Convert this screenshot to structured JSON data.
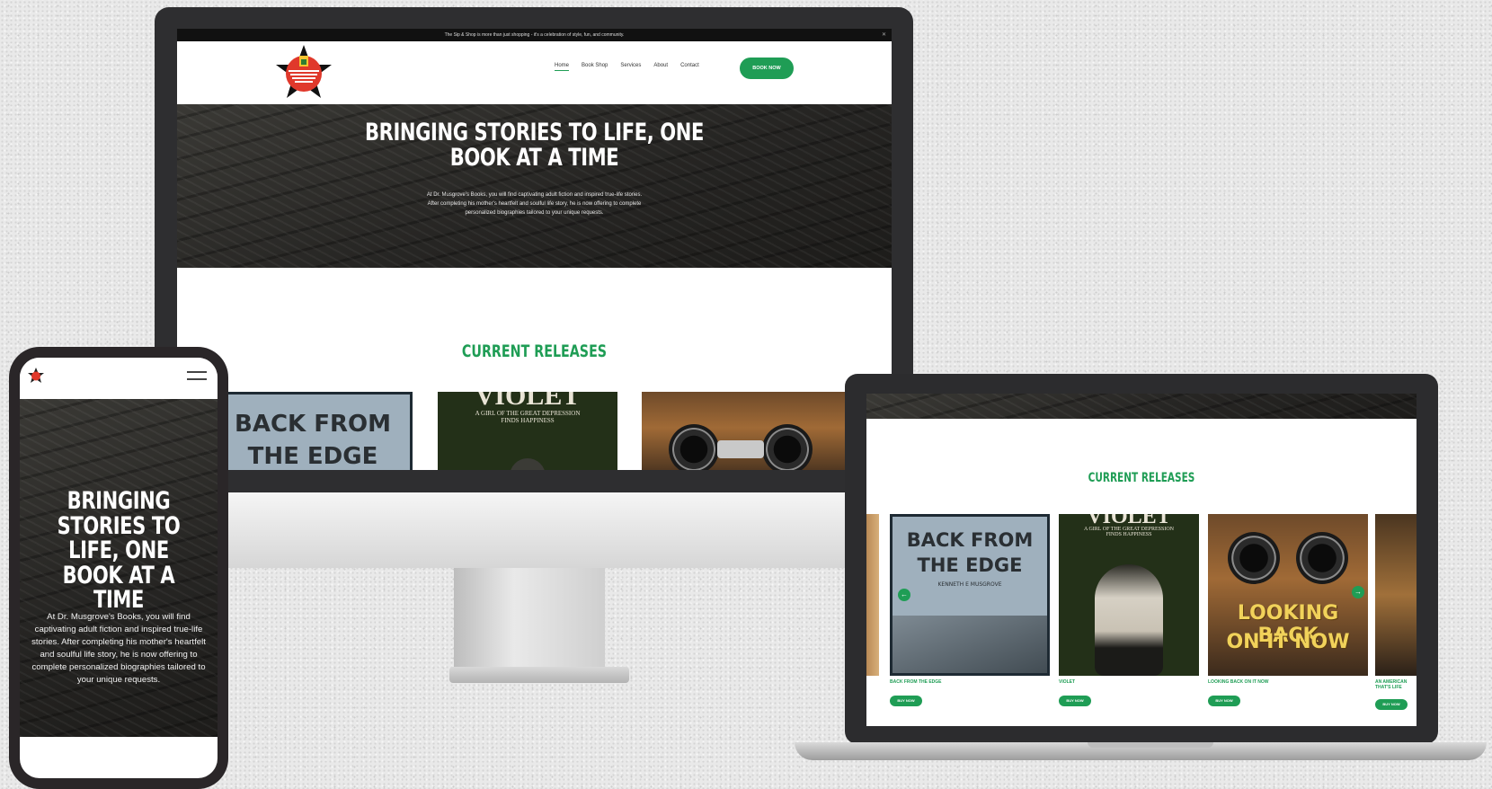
{
  "announcement": "The Sip & Shop is more than just shopping - it's a celebration of style, fun, and community.",
  "nav": {
    "items": [
      "Home",
      "Book Shop",
      "Services",
      "About",
      "Contact"
    ],
    "book_now": "BOOK NOW"
  },
  "hero": {
    "title": "BRINGING STORIES TO LIFE, ONE BOOK AT A TIME",
    "subtitle": "At Dr. Musgrove's Books, you will find captivating adult fiction and inspired true-life stories. After completing his mother's heartfelt and soulful life story, he is now offering to complete personalized biographies tailored to your unique requests."
  },
  "current_releases": "CURRENT RELEASES",
  "books": [
    {
      "cover_line1": "BACK FROM",
      "cover_line2": "THE EDGE",
      "author": "KENNETH E MUSGROVE",
      "title": "BACK FROM THE EDGE",
      "button": "BUY NOW"
    },
    {
      "cover_line1": "VIOLET",
      "cover_line2": "A GIRL OF THE GREAT DEPRESSION FINDS HAPPINESS",
      "title": "VIOLET",
      "button": "BUY NOW"
    },
    {
      "cover_line1": "LOOKING BACK",
      "cover_line2": "ON IT NOW",
      "title": "LOOKING BACK ON IT NOW",
      "button": "BUY NOW"
    },
    {
      "title": "AN AMERICAN THAT'S LIFE",
      "button": "BUY NOW"
    }
  ],
  "colors": {
    "accent": "#1f9d55",
    "dark": "#2b2a28"
  }
}
